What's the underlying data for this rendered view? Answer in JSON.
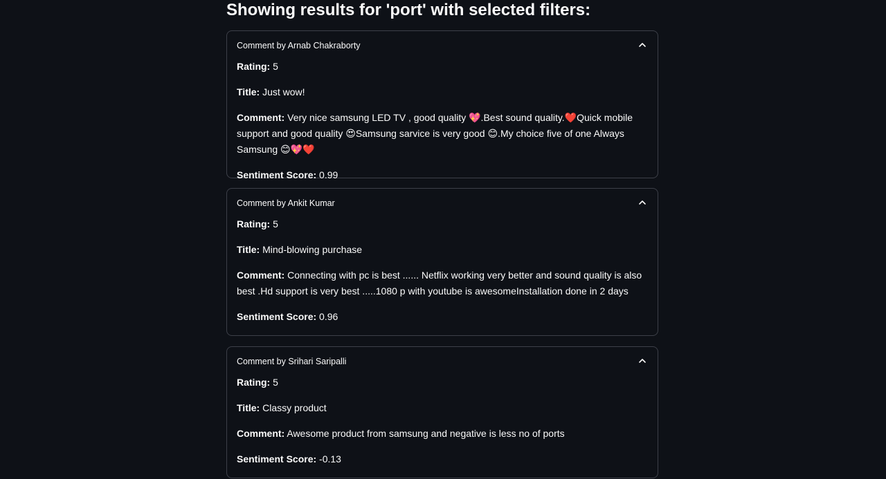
{
  "heading": "Showing results for 'port' with selected filters:",
  "labels": {
    "rating": "Rating:",
    "title": "Title:",
    "comment": "Comment:",
    "sentiment": "Sentiment Score:"
  },
  "results": [
    {
      "header": "Comment by Arnab Chakraborty",
      "rating": "5",
      "title": "Just wow!",
      "comment": "Very nice samsung LED TV , good quality 💖.Best sound quality.❤️Quick mobile support and good quality 😍Samsung sarvice is very good 😊.My choice five of one Always Samsung 😊💖❤️",
      "sentiment": "0.99"
    },
    {
      "header": "Comment by Ankit Kumar",
      "rating": "5",
      "title": "Mind-blowing purchase",
      "comment": "Connecting with pc is best ...... Netflix working very better and sound quality is also best .Hd support is very best .....1080 p with youtube is awesomeInstallation done in 2 days",
      "sentiment": "0.96"
    },
    {
      "header": "Comment by Srihari Saripalli",
      "rating": "5",
      "title": "Classy product",
      "comment": "Awesome product from samsung and negative is less no of ports",
      "sentiment": "-0.13"
    }
  ],
  "icons": {
    "collapse": "chevron-up-icon"
  },
  "colors": {
    "background": "#0e1117",
    "border": "#3d4049",
    "text": "#fafafa"
  }
}
